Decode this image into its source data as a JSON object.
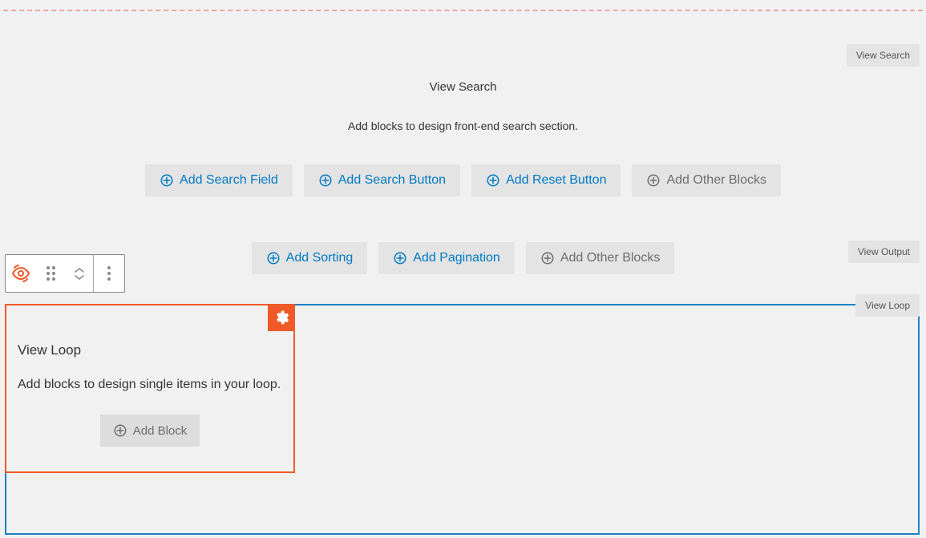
{
  "badges": {
    "search": "View Search",
    "output": "View Output",
    "loop": "View Loop"
  },
  "search_section": {
    "title": "View Search",
    "description": "Add blocks to design front-end search section.",
    "buttons": {
      "add_search_field": "Add Search Field",
      "add_search_button": "Add Search Button",
      "add_reset_button": "Add Reset Button",
      "add_other_blocks": "Add Other Blocks"
    }
  },
  "output_buttons": {
    "add_sorting": "Add Sorting",
    "add_pagination": "Add Pagination",
    "add_other_blocks": "Add Other Blocks"
  },
  "loop_box": {
    "title": "View Loop",
    "description": "Add blocks to design single items in your loop.",
    "add_block": "Add Block"
  }
}
